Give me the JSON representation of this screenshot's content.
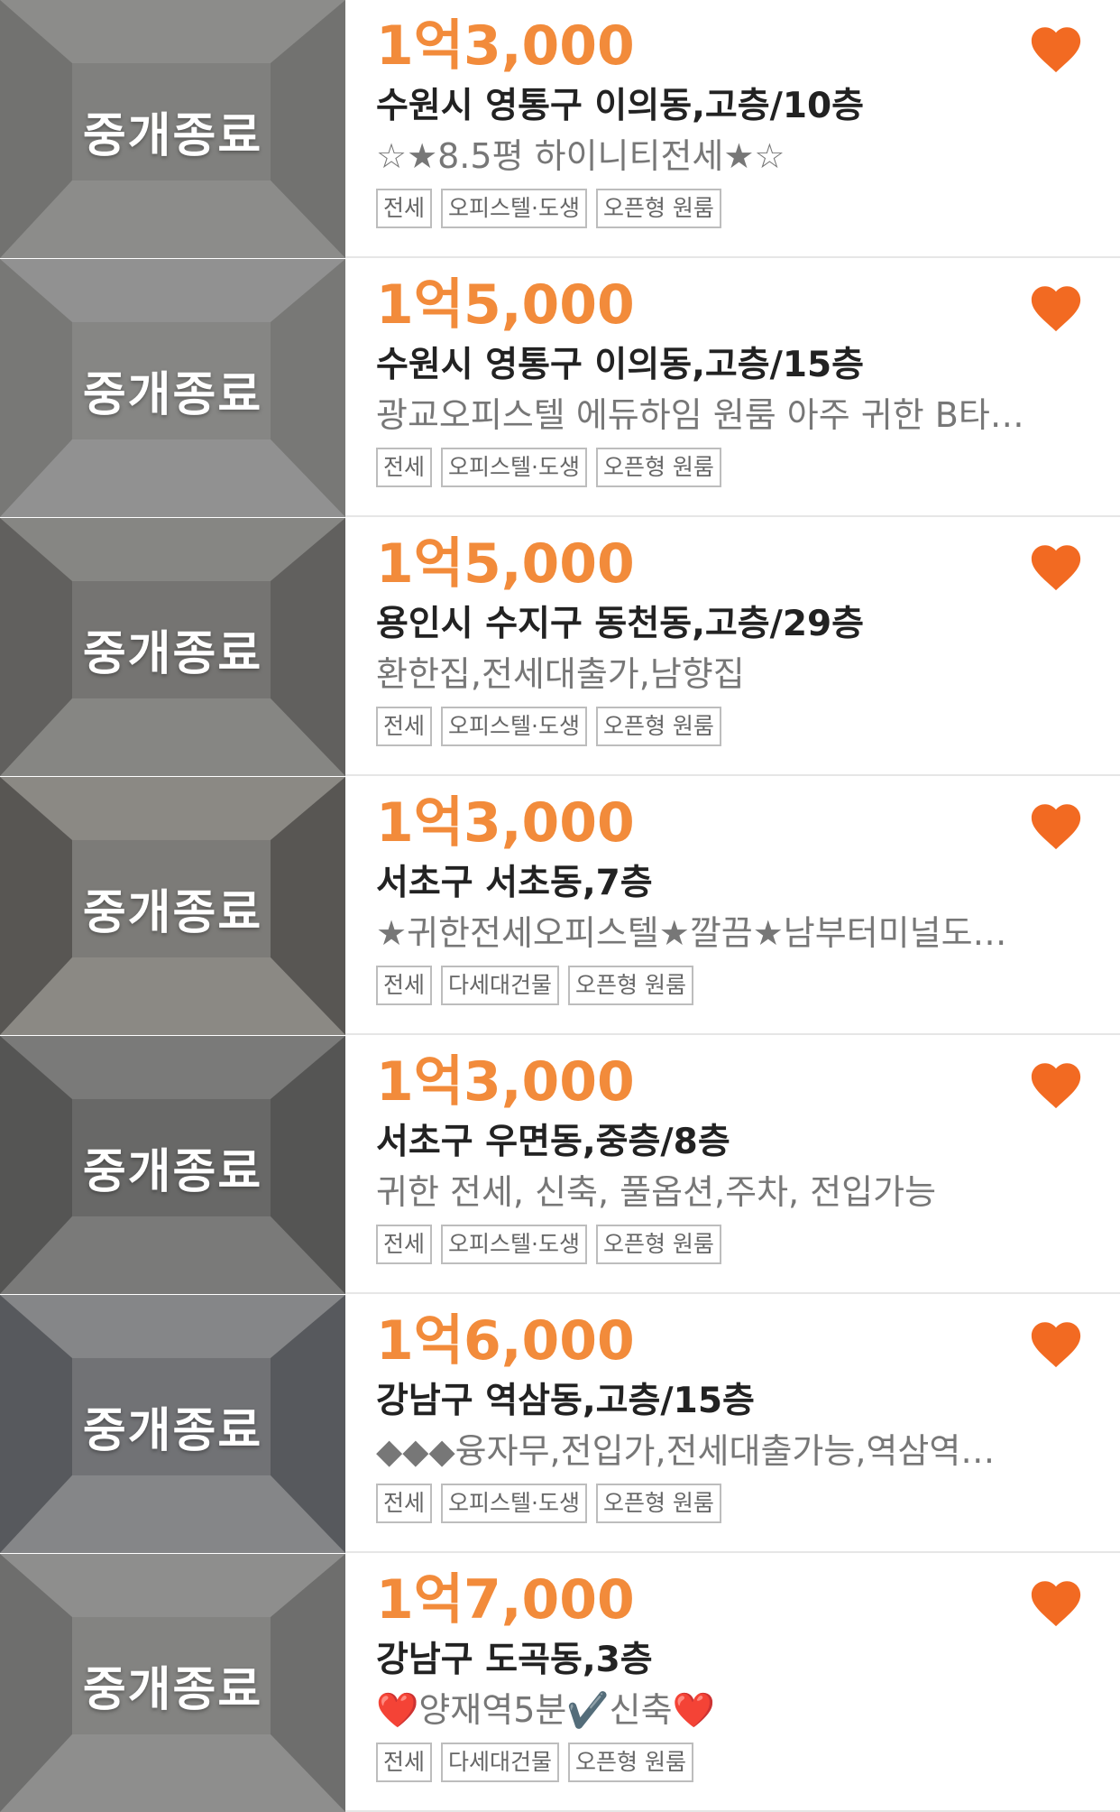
{
  "theme": {
    "price_color": "#f28b3b",
    "heart_color": "#f26a22",
    "address_color": "#222222",
    "desc_color": "#777777",
    "tag_border_color": "#bdbdbd"
  },
  "listings": [
    {
      "thumbnail_overlay": "중개종료",
      "price": "1억3,000",
      "address": "수원시 영통구 이의동,고층/10층",
      "description": "☆★8.5평 하이니티전세★☆",
      "tags": [
        "전세",
        "오피스텔·도생",
        "오픈형 원룸"
      ],
      "favorited": true,
      "heart_icon": "heart-icon"
    },
    {
      "thumbnail_overlay": "중개종료",
      "price": "1억5,000",
      "address": "수원시 영통구 이의동,고층/15층",
      "description": "광교오피스텔 에듀하임 원룸 아주 귀한 B타…",
      "tags": [
        "전세",
        "오피스텔·도생",
        "오픈형 원룸"
      ],
      "favorited": true,
      "heart_icon": "heart-icon"
    },
    {
      "thumbnail_overlay": "중개종료",
      "price": "1억5,000",
      "address": "용인시 수지구 동천동,고층/29층",
      "description": "환한집,전세대출가,남향집",
      "tags": [
        "전세",
        "오피스텔·도생",
        "오픈형 원룸"
      ],
      "favorited": true,
      "heart_icon": "heart-icon"
    },
    {
      "thumbnail_overlay": "중개종료",
      "price": "1억3,000",
      "address": "서초구 서초동,7층",
      "description": "★귀한전세오피스텔★깔끔★남부터미널도…",
      "tags": [
        "전세",
        "다세대건물",
        "오픈형 원룸"
      ],
      "favorited": true,
      "heart_icon": "heart-icon"
    },
    {
      "thumbnail_overlay": "중개종료",
      "price": "1억3,000",
      "address": "서초구 우면동,중층/8층",
      "description": "귀한 전세, 신축, 풀옵션,주차, 전입가능",
      "tags": [
        "전세",
        "오피스텔·도생",
        "오픈형 원룸"
      ],
      "favorited": true,
      "heart_icon": "heart-icon"
    },
    {
      "thumbnail_overlay": "중개종료",
      "price": "1억6,000",
      "address": "강남구 역삼동,고층/15층",
      "description": "◆◆◆융자무,전입가,전세대출가능,역삼역…",
      "tags": [
        "전세",
        "오피스텔·도생",
        "오픈형 원룸"
      ],
      "favorited": true,
      "heart_icon": "heart-icon"
    },
    {
      "thumbnail_overlay": "중개종료",
      "price": "1억7,000",
      "address": "강남구 도곡동,3층",
      "description": "❤️양재역5분✔️신축❤️",
      "tags": [
        "전세",
        "다세대건물",
        "오픈형 원룸"
      ],
      "favorited": true,
      "heart_icon": "heart-icon"
    }
  ]
}
